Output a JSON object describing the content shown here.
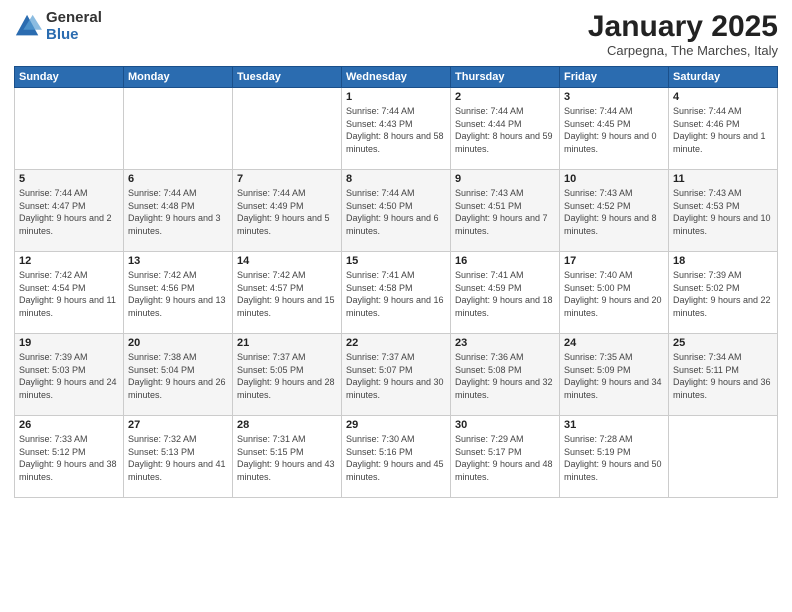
{
  "logo": {
    "general": "General",
    "blue": "Blue"
  },
  "title": "January 2025",
  "location": "Carpegna, The Marches, Italy",
  "days_of_week": [
    "Sunday",
    "Monday",
    "Tuesday",
    "Wednesday",
    "Thursday",
    "Friday",
    "Saturday"
  ],
  "weeks": [
    [
      {
        "day": "",
        "info": ""
      },
      {
        "day": "",
        "info": ""
      },
      {
        "day": "",
        "info": ""
      },
      {
        "day": "1",
        "info": "Sunrise: 7:44 AM\nSunset: 4:43 PM\nDaylight: 8 hours and 58 minutes."
      },
      {
        "day": "2",
        "info": "Sunrise: 7:44 AM\nSunset: 4:44 PM\nDaylight: 8 hours and 59 minutes."
      },
      {
        "day": "3",
        "info": "Sunrise: 7:44 AM\nSunset: 4:45 PM\nDaylight: 9 hours and 0 minutes."
      },
      {
        "day": "4",
        "info": "Sunrise: 7:44 AM\nSunset: 4:46 PM\nDaylight: 9 hours and 1 minute."
      }
    ],
    [
      {
        "day": "5",
        "info": "Sunrise: 7:44 AM\nSunset: 4:47 PM\nDaylight: 9 hours and 2 minutes."
      },
      {
        "day": "6",
        "info": "Sunrise: 7:44 AM\nSunset: 4:48 PM\nDaylight: 9 hours and 3 minutes."
      },
      {
        "day": "7",
        "info": "Sunrise: 7:44 AM\nSunset: 4:49 PM\nDaylight: 9 hours and 5 minutes."
      },
      {
        "day": "8",
        "info": "Sunrise: 7:44 AM\nSunset: 4:50 PM\nDaylight: 9 hours and 6 minutes."
      },
      {
        "day": "9",
        "info": "Sunrise: 7:43 AM\nSunset: 4:51 PM\nDaylight: 9 hours and 7 minutes."
      },
      {
        "day": "10",
        "info": "Sunrise: 7:43 AM\nSunset: 4:52 PM\nDaylight: 9 hours and 8 minutes."
      },
      {
        "day": "11",
        "info": "Sunrise: 7:43 AM\nSunset: 4:53 PM\nDaylight: 9 hours and 10 minutes."
      }
    ],
    [
      {
        "day": "12",
        "info": "Sunrise: 7:42 AM\nSunset: 4:54 PM\nDaylight: 9 hours and 11 minutes."
      },
      {
        "day": "13",
        "info": "Sunrise: 7:42 AM\nSunset: 4:56 PM\nDaylight: 9 hours and 13 minutes."
      },
      {
        "day": "14",
        "info": "Sunrise: 7:42 AM\nSunset: 4:57 PM\nDaylight: 9 hours and 15 minutes."
      },
      {
        "day": "15",
        "info": "Sunrise: 7:41 AM\nSunset: 4:58 PM\nDaylight: 9 hours and 16 minutes."
      },
      {
        "day": "16",
        "info": "Sunrise: 7:41 AM\nSunset: 4:59 PM\nDaylight: 9 hours and 18 minutes."
      },
      {
        "day": "17",
        "info": "Sunrise: 7:40 AM\nSunset: 5:00 PM\nDaylight: 9 hours and 20 minutes."
      },
      {
        "day": "18",
        "info": "Sunrise: 7:39 AM\nSunset: 5:02 PM\nDaylight: 9 hours and 22 minutes."
      }
    ],
    [
      {
        "day": "19",
        "info": "Sunrise: 7:39 AM\nSunset: 5:03 PM\nDaylight: 9 hours and 24 minutes."
      },
      {
        "day": "20",
        "info": "Sunrise: 7:38 AM\nSunset: 5:04 PM\nDaylight: 9 hours and 26 minutes."
      },
      {
        "day": "21",
        "info": "Sunrise: 7:37 AM\nSunset: 5:05 PM\nDaylight: 9 hours and 28 minutes."
      },
      {
        "day": "22",
        "info": "Sunrise: 7:37 AM\nSunset: 5:07 PM\nDaylight: 9 hours and 30 minutes."
      },
      {
        "day": "23",
        "info": "Sunrise: 7:36 AM\nSunset: 5:08 PM\nDaylight: 9 hours and 32 minutes."
      },
      {
        "day": "24",
        "info": "Sunrise: 7:35 AM\nSunset: 5:09 PM\nDaylight: 9 hours and 34 minutes."
      },
      {
        "day": "25",
        "info": "Sunrise: 7:34 AM\nSunset: 5:11 PM\nDaylight: 9 hours and 36 minutes."
      }
    ],
    [
      {
        "day": "26",
        "info": "Sunrise: 7:33 AM\nSunset: 5:12 PM\nDaylight: 9 hours and 38 minutes."
      },
      {
        "day": "27",
        "info": "Sunrise: 7:32 AM\nSunset: 5:13 PM\nDaylight: 9 hours and 41 minutes."
      },
      {
        "day": "28",
        "info": "Sunrise: 7:31 AM\nSunset: 5:15 PM\nDaylight: 9 hours and 43 minutes."
      },
      {
        "day": "29",
        "info": "Sunrise: 7:30 AM\nSunset: 5:16 PM\nDaylight: 9 hours and 45 minutes."
      },
      {
        "day": "30",
        "info": "Sunrise: 7:29 AM\nSunset: 5:17 PM\nDaylight: 9 hours and 48 minutes."
      },
      {
        "day": "31",
        "info": "Sunrise: 7:28 AM\nSunset: 5:19 PM\nDaylight: 9 hours and 50 minutes."
      },
      {
        "day": "",
        "info": ""
      }
    ]
  ]
}
